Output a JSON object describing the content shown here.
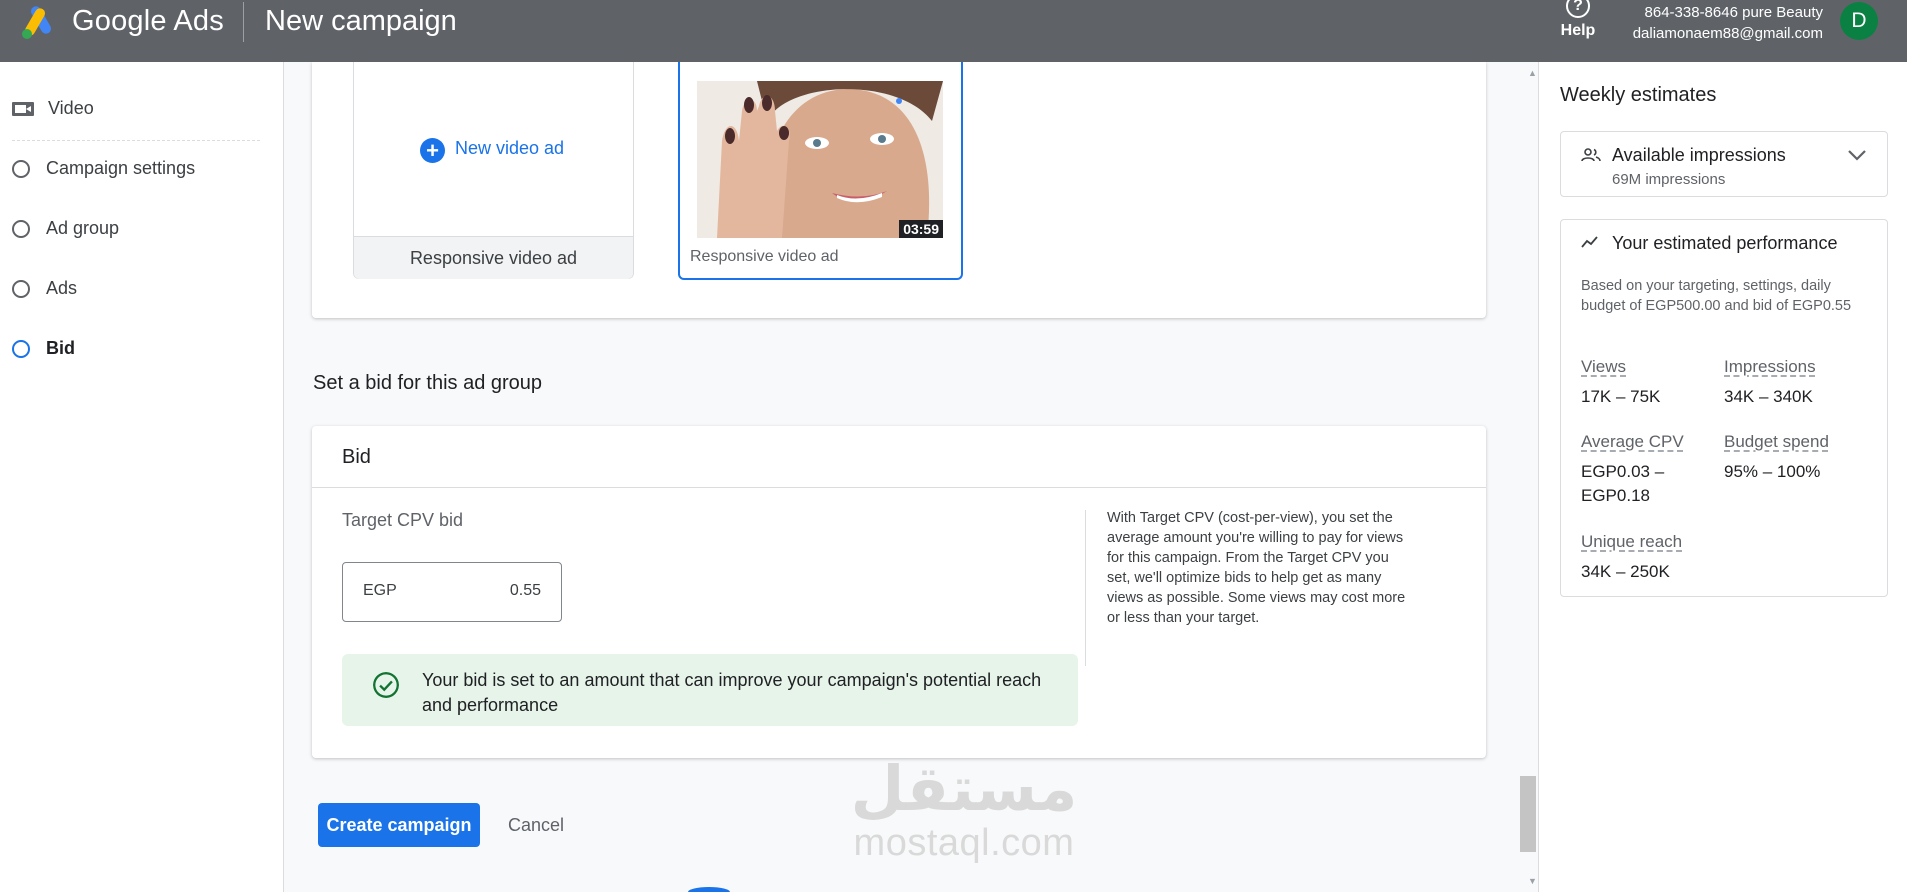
{
  "header": {
    "brand": "Google Ads",
    "page_title": "New campaign",
    "help_label": "Help",
    "account_name": "864-338-8646 pure Beauty",
    "account_email": "daliamonaem88@gmail.com",
    "avatar_letter": "D"
  },
  "sidebar": {
    "items": [
      {
        "label": "Video"
      },
      {
        "label": "Campaign settings"
      },
      {
        "label": "Ad group"
      },
      {
        "label": "Ads"
      },
      {
        "label": "Bid"
      }
    ]
  },
  "ads": {
    "new_ad_label": "New video ad",
    "new_ad_type": "Responsive video ad",
    "selected_ad_duration": "03:59",
    "selected_ad_type": "Responsive video ad"
  },
  "bid": {
    "section_title": "Set a bid for this ad group",
    "card_title": "Bid",
    "field_label": "Target CPV bid",
    "currency": "EGP",
    "value": "0.55",
    "help_text": "With Target CPV (cost-per-view), you set the average amount you're willing to pay for views for this campaign. From the Target CPV you set, we'll optimize bids to help get as many views as possible. Some views may cost more or less than your target.",
    "success_message": "Your bid is set to an amount that can improve your campaign's potential reach and performance"
  },
  "actions": {
    "create_label": "Create campaign",
    "cancel_label": "Cancel"
  },
  "watermark": {
    "arabic": "مستقل",
    "latin": "mostaql.com"
  },
  "estimates": {
    "title": "Weekly estimates",
    "impressions_title": "Available impressions",
    "impressions_value": "69M impressions",
    "performance_title": "Your estimated performance",
    "performance_desc": "Based on your targeting, settings, daily budget of EGP500.00 and bid of EGP0.55",
    "metrics": [
      {
        "label": "Views",
        "value": "17K – 75K"
      },
      {
        "label": "Impressions",
        "value": "34K – 340K"
      },
      {
        "label": "Average CPV",
        "value": "EGP0.03 – EGP0.18"
      },
      {
        "label": "Budget spend",
        "value": "95% – 100%"
      },
      {
        "label": "Unique reach",
        "value": "34K – 250K"
      }
    ]
  },
  "colors": {
    "header_bg": "#5f6368",
    "accent": "#1a73e8",
    "success_bg": "#e6f4ea",
    "success_icon": "#137333",
    "avatar_bg": "#0b8043"
  }
}
